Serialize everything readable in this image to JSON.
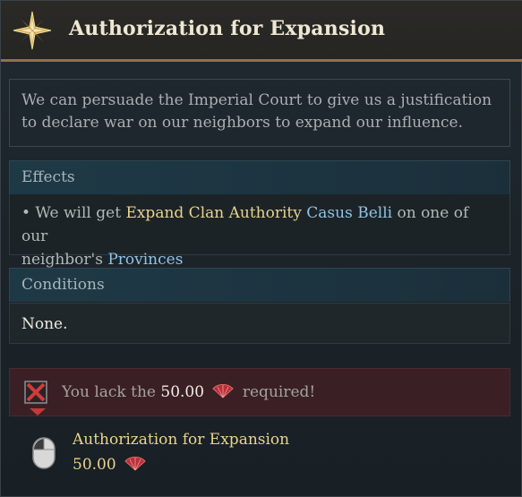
{
  "header": {
    "title": "Authorization for Expansion"
  },
  "description": {
    "line1": "We can persuade the Imperial Court to give us a justification",
    "line2": "to declare war on our neighbors to expand our influence."
  },
  "effects": {
    "heading": "Effects",
    "bullet_prefix": "• We will get",
    "authority_name": "Expand Clan Authority",
    "casus_belli": "Casus Belli",
    "middle_text": "on one of our",
    "line2_prefix": "neighbor's",
    "provinces": "Provinces"
  },
  "conditions": {
    "heading": "Conditions",
    "value": "None."
  },
  "requirement": {
    "prefix": "You lack the",
    "amount": "50.00",
    "suffix": "required!"
  },
  "action": {
    "name": "Authorization for Expansion",
    "cost": "50.00"
  },
  "colors": {
    "highlight_gold": "#e8d48c",
    "highlight_blue": "#8fc3e6",
    "warning_red": "#c23a3a",
    "header_border": "#8c7445"
  }
}
